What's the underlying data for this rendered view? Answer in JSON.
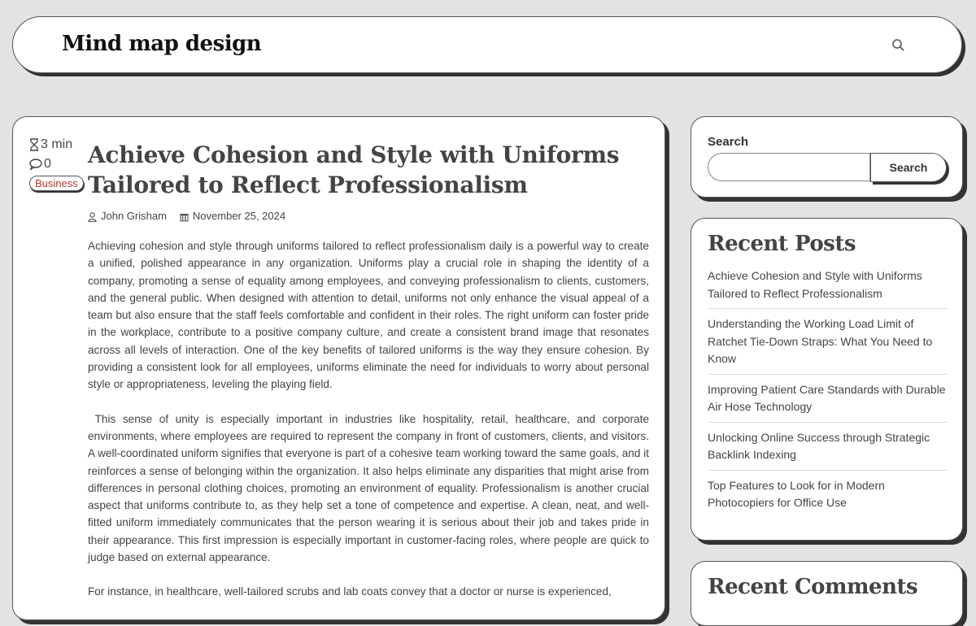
{
  "site": {
    "title": "Mind map design"
  },
  "post": {
    "read_time": "3 min",
    "comments_count": "0",
    "category": "Business",
    "title": "Achieve Cohesion and Style with Uniforms Tailored to Reflect Professionalism",
    "author": "John Grisham",
    "date": "November 25, 2024",
    "paragraphs": [
      "Achieving cohesion and style through uniforms tailored to reflect professionalism daily is a powerful way to create a unified, polished appearance in any organization. Uniforms play a crucial role in shaping the identity of a company, promoting a sense of equality among employees, and conveying professionalism to clients, customers, and the general public. When designed with attention to detail, uniforms not only enhance the visual appeal of a team but also ensure that the staff feels comfortable and confident in their roles. The right uniform can foster pride in the workplace, contribute to a positive company culture, and create a consistent brand image that resonates across all levels of interaction. One of the key benefits of tailored uniforms is the way they ensure cohesion. By providing a consistent look for all employees, uniforms eliminate the need for individuals to worry about personal style or appropriateness, leveling the playing field.",
      " This sense of unity is especially important in industries like hospitality, retail, healthcare, and corporate environments, where employees are required to represent the company in front of customers, clients, and visitors. A well-coordinated uniform signifies that everyone is part of a cohesive team working toward the same goals, and it reinforces a sense of belonging within the organization. It also helps eliminate any disparities that might arise from differences in personal clothing choices, promoting an environment of equality. Professionalism is another crucial aspect that uniforms contribute to, as they help set a tone of competence and expertise. A clean, neat, and well-fitted uniform immediately communicates that the person wearing it is serious about their job and takes pride in their appearance. This first impression is especially important in customer-facing roles, where people are quick to judge based on external appearance.",
      "For instance, in healthcare, well-tailored scrubs and lab coats convey that a doctor or nurse is experienced,"
    ]
  },
  "sidebar": {
    "search": {
      "label": "Search",
      "button": "Search",
      "value": ""
    },
    "recent_posts": {
      "title": "Recent Posts",
      "items": [
        "Achieve Cohesion and Style with Uniforms Tailored to Reflect Professionalism",
        "Understanding the Working Load Limit of Ratchet Tie-Down Straps: What You Need to Know",
        "Improving Patient Care Standards with Durable Air Hose Technology",
        "Unlocking Online Success through Strategic Backlink Indexing",
        "Top Features to Look for in Modern Photocopiers for Office Use"
      ]
    },
    "recent_comments": {
      "title": "Recent Comments"
    }
  },
  "icons": {
    "header_search": "search-icon",
    "read_time": "hourglass-icon",
    "comments": "comment-icon",
    "author": "user-icon",
    "date": "calendar-icon"
  },
  "colors": {
    "category_badge": "#c0392b",
    "background": "#e3e3e3"
  }
}
